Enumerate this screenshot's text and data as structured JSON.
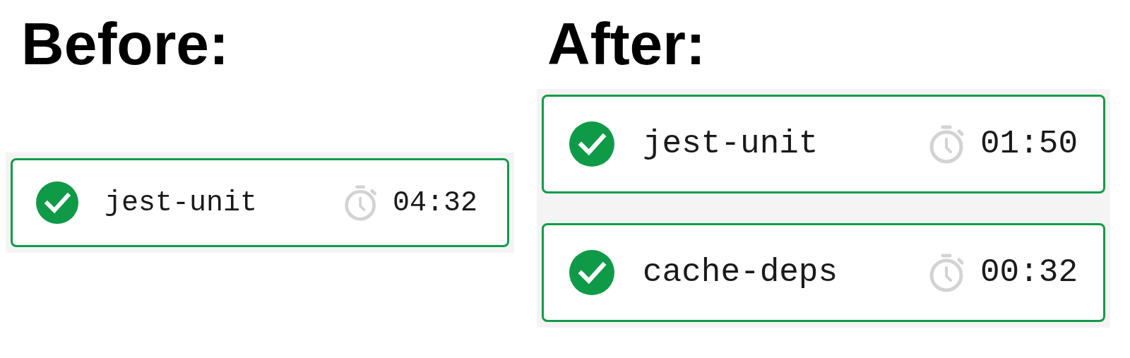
{
  "sections": [
    {
      "heading": "Before:",
      "jobs": [
        {
          "name": "jest-unit",
          "passed": true,
          "duration": "04:32"
        }
      ]
    },
    {
      "heading": "After:",
      "jobs": [
        {
          "name": "jest-unit",
          "passed": true,
          "duration": "01:50"
        },
        {
          "name": "cache-deps",
          "passed": true,
          "duration": "00:32"
        }
      ]
    }
  ]
}
